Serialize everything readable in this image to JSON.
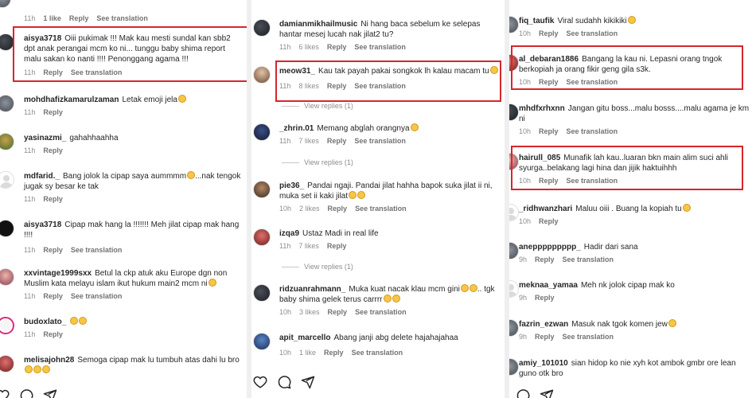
{
  "col1": {
    "top_meta": {
      "time": "11h",
      "likes": "1 like",
      "reply": "Reply",
      "translate": "See translation"
    },
    "comments": [
      {
        "user": "aisya3718",
        "text": "Oiii pukimak !!! Mak kau mesti sundal kan sbb2 dpt anak perangai mcm ko ni... tunggu baby shima report malu sakan ko nanti !!!! Penonggang agama !!!",
        "time": "11h",
        "reply": "Reply",
        "translate": "See translation"
      },
      {
        "user": "mohdhafizkamarulzaman",
        "text": "Letak emoji jela",
        "time": "11h",
        "reply": "Reply"
      },
      {
        "user": "yasinazmi_",
        "text": "gahahhaahha",
        "time": "11h",
        "reply": "Reply"
      },
      {
        "user": "mdfarid._",
        "text": "Bang jolok la cipap saya aummmm",
        "text2": "...nak tengok jugak sy besar ke tak",
        "time": "11h",
        "reply": "Reply"
      },
      {
        "user": "aisya3718",
        "text": "Cipap mak hang la !!!!!!! Meh jilat cipap mak hang !!!!",
        "time": "11h",
        "reply": "Reply",
        "translate": "See translation"
      },
      {
        "user": "xxvintage1999sxx",
        "text": "Betul la ckp atuk aku Europe dgn non Muslim kata melayu islam ikut hukum main2 mcm ni",
        "time": "11h",
        "reply": "Reply",
        "translate": "See translation"
      },
      {
        "user": "budoxlato_",
        "text": "",
        "time": "11h",
        "reply": "Reply"
      },
      {
        "user": "melisajohn28",
        "text": "Semoga cipap mak lu tumbuh atas dahi lu bro",
        "time": "",
        "reply": ""
      }
    ]
  },
  "col2": {
    "comments": [
      {
        "user": "damianmikhailmusic",
        "text": "Ni hang baca sebelum ke selepas hantar mesej lucah nak jilat2 tu?",
        "time": "11h",
        "likes": "6 likes",
        "reply": "Reply",
        "translate": "See translation"
      },
      {
        "user": "meow31_",
        "text": "Kau tak payah pakai songkok lh kalau macam tu",
        "time": "11h",
        "likes": "8 likes",
        "reply": "Reply",
        "translate": "See translation",
        "view_replies": "View replies (1)"
      },
      {
        "user": "_zhrin.01",
        "text": "Memang abglah orangnya",
        "time": "11h",
        "likes": "7 likes",
        "reply": "Reply",
        "translate": "See translation",
        "view_replies": "View replies (1)"
      },
      {
        "user": "pie36_",
        "text": "Pandai ngaji. Pandai jilat hahha bapok suka jilat ii ni, muka set ii kaki jilat",
        "time": "10h",
        "likes": "2 likes",
        "reply": "Reply",
        "translate": "See translation"
      },
      {
        "user": "izqa9",
        "text": "Ustaz Madi in real life",
        "time": "11h",
        "likes": "7 likes",
        "reply": "Reply",
        "view_replies": "View replies (1)"
      },
      {
        "user": "ridzuanrahmann_",
        "text": "Muka kuat nacak klau mcm gini",
        "text_tail": ".. tgk baby shima gelek terus carrrr",
        "time": "10h",
        "likes": "3 likes",
        "reply": "Reply",
        "translate": "See translation"
      },
      {
        "user": "apit_marcello",
        "text": "Abang janji abg delete hajahajahaa",
        "time": "10h",
        "likes": "1 like",
        "reply": "Reply",
        "translate": "See translation"
      }
    ]
  },
  "col3": {
    "comments": [
      {
        "user": "fiq_taufik",
        "text": "Viral sudahh kikikiki",
        "time": "10h",
        "reply": "Reply",
        "translate": "See translation"
      },
      {
        "user": "al_debaran1886",
        "text": "Bangang la kau ni. Lepasni orang tngok berkopiah ja orang fikir geng gila s3k.",
        "time": "10h",
        "reply": "Reply",
        "translate": "See translation"
      },
      {
        "user": "mhdfxrhxnn",
        "text": "Jangan gitu boss...malu bosss....malu agama je km ni",
        "time": "10h",
        "reply": "Reply",
        "translate": "See translation"
      },
      {
        "user": "hairull_085",
        "text": "Munafik lah kau..luaran bkn main alim suci ahli syurga..belakang lagi hina dan jijik haktuihhh",
        "time": "10h",
        "reply": "Reply",
        "translate": "See translation"
      },
      {
        "user": "_ridhwanzhari",
        "text": "Maluu oiii . Buang la kopiah tu",
        "time": "10h",
        "reply": "Reply"
      },
      {
        "user": "aneppppppppp_",
        "text": "Hadir dari sana",
        "time": "9h",
        "reply": "Reply",
        "translate": "See translation"
      },
      {
        "user": "meknaa_yamaa",
        "text": "Meh nk jolok cipap mak ko",
        "time": "9h",
        "reply": "Reply"
      },
      {
        "user": "fazrin_ezwan",
        "text": "Masuk nak tgok komen jew",
        "time": "9h",
        "reply": "Reply",
        "translate": "See translation"
      },
      {
        "user": "amiy_101010",
        "text": "sian hidop ko nie xyh kot ambok gmbr ore lean guno otk bro",
        "time": "",
        "reply": ""
      }
    ]
  },
  "colors": {
    "highlight": "#d6262c",
    "meta": "#8e8e8e",
    "text": "#262626"
  }
}
